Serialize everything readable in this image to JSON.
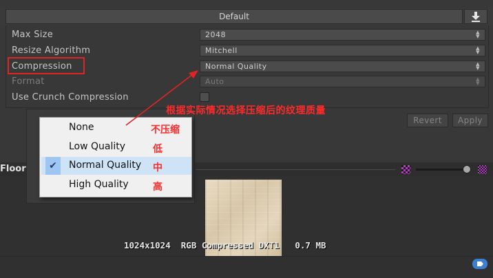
{
  "tab": {
    "label": "Default"
  },
  "settings": {
    "max_size": {
      "label": "Max Size",
      "value": "2048"
    },
    "resize_algorithm": {
      "label": "Resize Algorithm",
      "value": "Mitchell"
    },
    "compression": {
      "label": "Compression",
      "value": "Normal Quality"
    },
    "format": {
      "label": "Format",
      "value": "Auto"
    },
    "crunch": {
      "label": "Use Crunch Compression",
      "checked": false
    }
  },
  "buttons": {
    "revert": "Revert",
    "apply": "Apply"
  },
  "dropdown": {
    "items": [
      {
        "label": "None",
        "selected": false
      },
      {
        "label": "Low Quality",
        "selected": false
      },
      {
        "label": "Normal Quality",
        "selected": true
      },
      {
        "label": "High Quality",
        "selected": false
      }
    ],
    "check_glyph": "✔"
  },
  "annotations": {
    "main": "根据实际情况选择压缩后的纹理质量",
    "none": "不压缩",
    "low": "低",
    "normal": "中",
    "high": "高"
  },
  "preview": {
    "title": "Floor",
    "info": "1024x1024  RGB Compressed DXT1   0.7 MB"
  },
  "colors": {
    "annotation_red": "#e02424",
    "menu_highlight": "#cfe3f7",
    "check_bg": "#9dc7f0"
  }
}
